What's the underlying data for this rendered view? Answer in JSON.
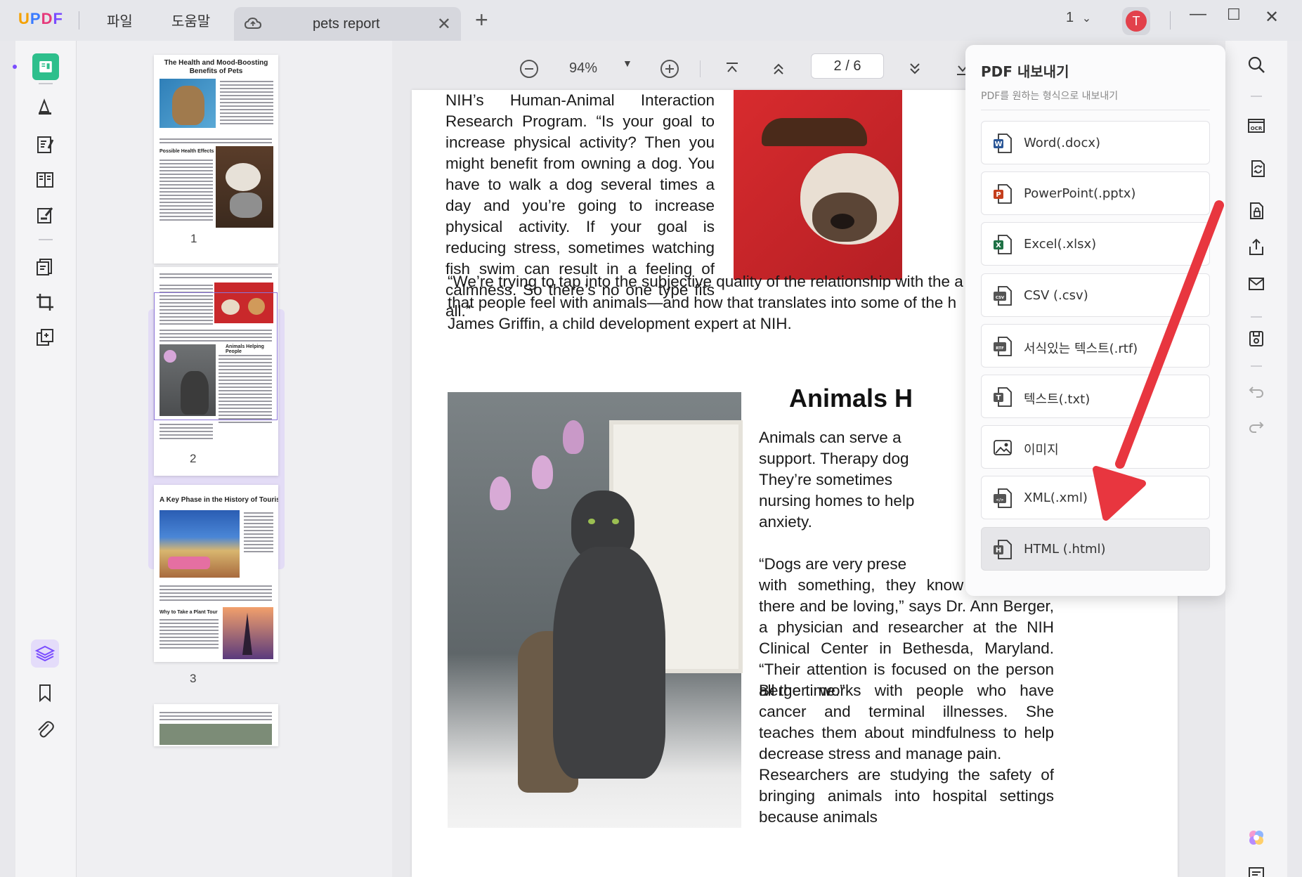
{
  "app": {
    "logo": "UPDF",
    "menu": [
      "파일",
      "도움말"
    ],
    "tab_title": "pets report",
    "page_indicator": "1",
    "avatar_letter": "T"
  },
  "toolbar": {
    "zoom": "94%",
    "page_current": "2",
    "page_total": "6",
    "page_display": "2  /  6"
  },
  "thumbnails": [
    {
      "num": "1",
      "title": "The Health and Mood-Boosting Benefits of Pets",
      "subheading": "Possible Health Effects"
    },
    {
      "num": "2",
      "title": "",
      "subheading": "Animals Helping People"
    },
    {
      "num": "3",
      "title": "A Key Phase in the History of Tourism",
      "subheading": "Why to Take a Plant Tour"
    }
  ],
  "document": {
    "para1": "NIH’s Human-Animal Interaction Research Program. “Is your goal to increase physical activity? Then you might benefit from owning a dog. You have to walk a dog several times a day and you’re going to increase physical activity. If your goal is reducing stress, sometimes watching fish swim can result in a feeling of calmness. So there’s no one type fits all.”",
    "quote_lines": [
      "“We’re trying to tap into the subjective quality of the relationship with the a",
      "that people feel with animals—and how that translates into some of the h",
      "James Griffin, a child development expert at NIH."
    ],
    "heading": "Animals H",
    "col_lines": [
      "Animals can serve a",
      "support. Therapy dog",
      "They’re sometimes",
      "nursing homes to help",
      "anxiety."
    ],
    "dogs_first": "“Dogs are very prese",
    "para_dogs": "with something, they know how to sit there and be loving,” says Dr. Ann Berger, a physician and researcher at the NIH Clinical Center in Bethesda, Maryland. “Their attention is focused on the person all the time.”",
    "para_berger": "Berger works with people who have cancer and terminal illnesses. She teaches them about mindfulness to help decrease stress and manage pain.",
    "para_research": "Researchers are studying the safety of bringing animals into hospital settings because animals"
  },
  "export_popup": {
    "title": "PDF 내보내기",
    "subtitle": "PDF를 원하는 형식으로 내보내기",
    "options": [
      {
        "label": "Word(.docx)",
        "icon": "word-icon",
        "color": "#2b5797",
        "glyph": "W"
      },
      {
        "label": "PowerPoint(.pptx)",
        "icon": "powerpoint-icon",
        "color": "#c43e1c",
        "glyph": "P"
      },
      {
        "label": "Excel(.xlsx)",
        "icon": "excel-icon",
        "color": "#1e7145",
        "glyph": "X"
      },
      {
        "label": "CSV (.csv)",
        "icon": "csv-icon",
        "color": "#555555",
        "glyph": "CSV"
      },
      {
        "label": "서식있는 텍스트(.rtf)",
        "icon": "rtf-icon",
        "color": "#555555",
        "glyph": "RTF"
      },
      {
        "label": "텍스트(.txt)",
        "icon": "txt-icon",
        "color": "#555555",
        "glyph": "T"
      },
      {
        "label": "이미지",
        "icon": "image-icon",
        "color": "#555555",
        "glyph": ""
      },
      {
        "label": "XML(.xml)",
        "icon": "xml-icon",
        "color": "#555555",
        "glyph": "</>"
      },
      {
        "label": "HTML (.html)",
        "icon": "html-icon",
        "color": "#555555",
        "glyph": "H"
      }
    ],
    "selected_index": 8
  },
  "colors": {
    "accent": "#2f6bff",
    "annotation_arrow": "#e8363f",
    "selection": "#e3dcf6"
  }
}
